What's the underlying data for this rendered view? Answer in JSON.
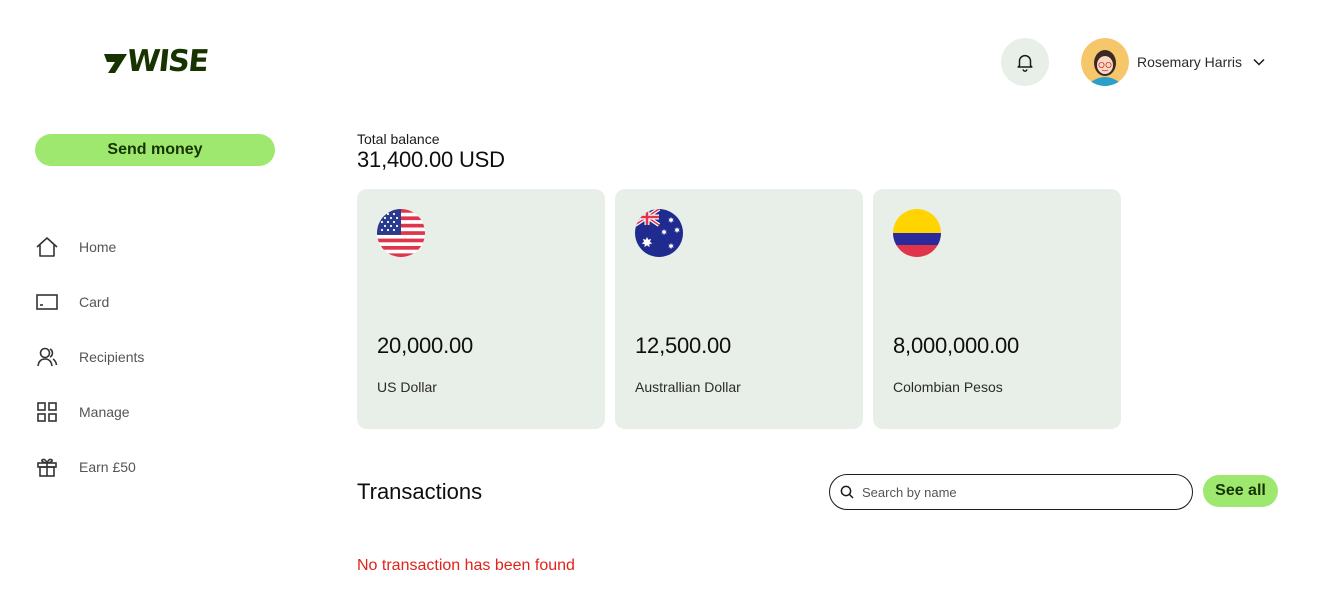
{
  "brand": {
    "name": "7WISE",
    "logo_text": "WISE",
    "color": "#163300"
  },
  "header": {
    "notifications_icon": "bell-icon",
    "user": {
      "name": "Rosemary Harris",
      "avatar": "user-avatar",
      "menu_icon": "chevron-down-icon"
    }
  },
  "sidebar": {
    "send_money_label": "Send money",
    "items": [
      {
        "label": "Home",
        "icon": "home-icon"
      },
      {
        "label": "Card",
        "icon": "card-icon"
      },
      {
        "label": "Recipients",
        "icon": "recipients-icon"
      },
      {
        "label": "Manage",
        "icon": "grid-icon"
      },
      {
        "label": "Earn £50",
        "icon": "gift-icon"
      }
    ]
  },
  "balance": {
    "total_label": "Total balance",
    "total_value": "31,400.00 USD",
    "accounts": [
      {
        "amount": "20,000.00",
        "currency": "US Dollar",
        "flag": "us-flag-icon"
      },
      {
        "amount": "12,500.00",
        "currency": "Australlian Dollar",
        "flag": "au-flag-icon"
      },
      {
        "amount": "8,000,000.00",
        "currency": "Colombian Pesos",
        "flag": "co-flag-icon"
      }
    ]
  },
  "transactions": {
    "title": "Transactions",
    "search_placeholder": "Search by name",
    "see_all_label": "See all",
    "empty_message": "No transaction has been found"
  },
  "colors": {
    "accent": "#9fe870",
    "card_bg": "#e8efe9",
    "error": "#e0231b"
  }
}
